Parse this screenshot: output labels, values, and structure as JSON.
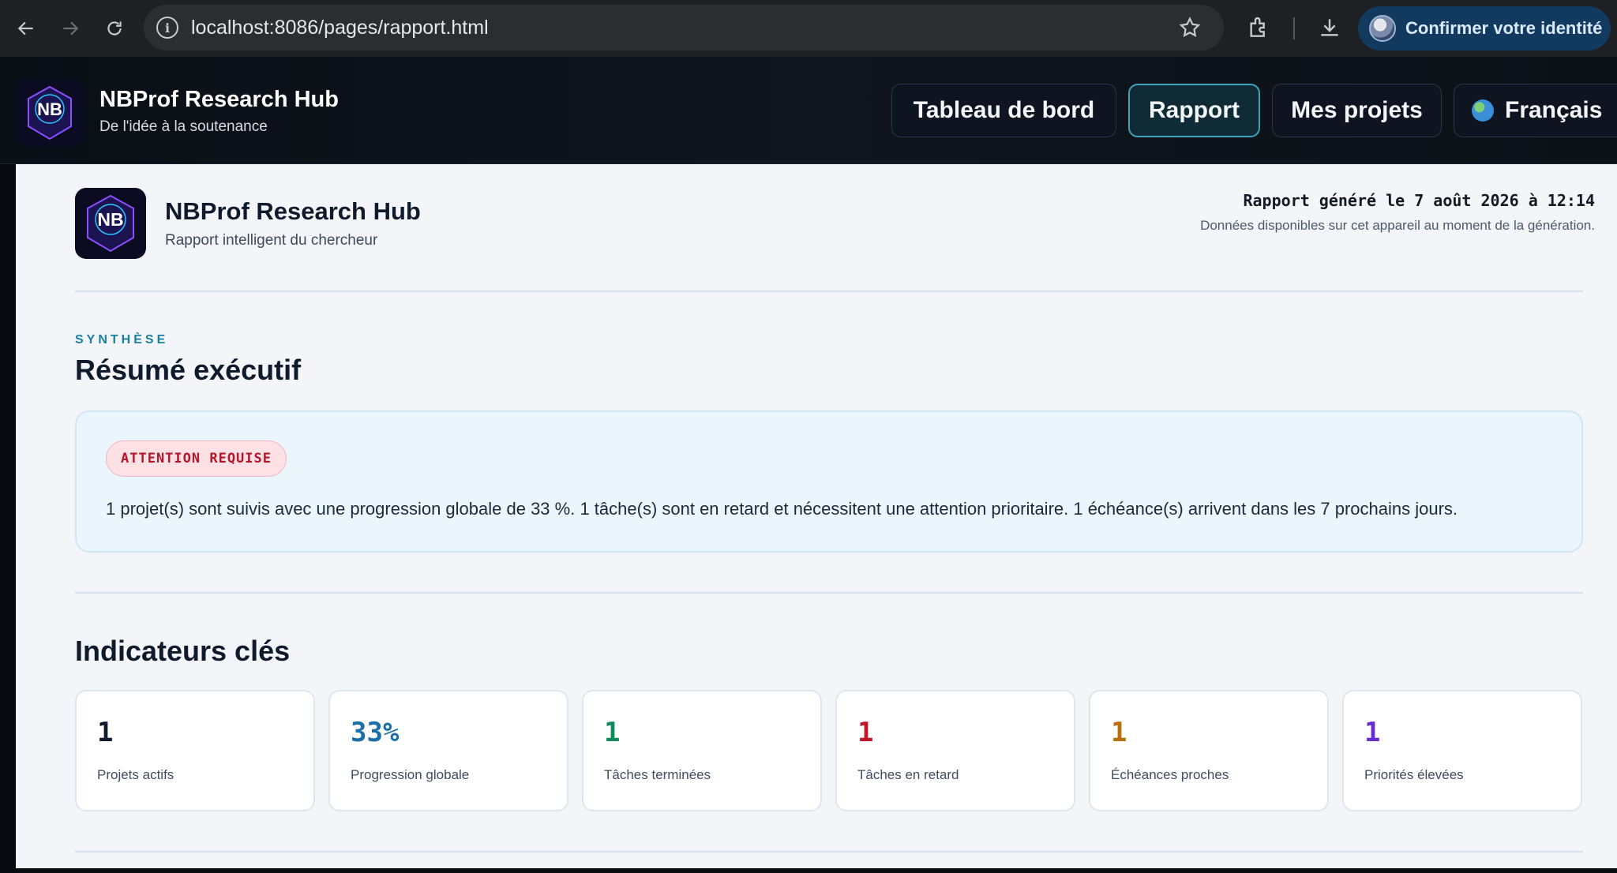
{
  "browser": {
    "url": "localhost:8086/pages/rapport.html",
    "identity_button": "Confirmer votre identité"
  },
  "app": {
    "brand_title": "NBProf Research Hub",
    "brand_subtitle": "De l'idée à la soutenance",
    "nav": {
      "dashboard": "Tableau de bord",
      "report": "Rapport",
      "projects": "Mes projets",
      "language": "Français"
    }
  },
  "report": {
    "title": "NBProf Research Hub",
    "subtitle": "Rapport intelligent du chercheur",
    "generated": "Rapport généré le 7 août 2026 à 12:14",
    "generated_note": "Données disponibles sur cet appareil au moment de la génération.",
    "synthesis": {
      "eyebrow": "SYNTHÈSE",
      "heading": "Résumé exécutif",
      "badge": "ATTENTION REQUISE",
      "text": "1 projet(s) sont suivis avec une progression globale de 33 %. 1 tâche(s) sont en retard et nécessitent une attention prioritaire. 1 échéance(s) arrivent dans les 7 prochains jours."
    },
    "kpi_heading": "Indicateurs clés",
    "kpis": [
      {
        "value": "1",
        "label": "Projets actifs",
        "color": "#0f1b2d"
      },
      {
        "value": "33%",
        "label": "Progression globale",
        "color": "#1a6fa8"
      },
      {
        "value": "1",
        "label": "Tâches terminées",
        "color": "#0f8a5a"
      },
      {
        "value": "1",
        "label": "Tâches en retard",
        "color": "#c4162a"
      },
      {
        "value": "1",
        "label": "Échéances proches",
        "color": "#b86e0a"
      },
      {
        "value": "1",
        "label": "Priorités élevées",
        "color": "#6a2bd6"
      }
    ]
  },
  "colors": {
    "accent": "#1a7fa0",
    "alert": "#b3152a"
  }
}
